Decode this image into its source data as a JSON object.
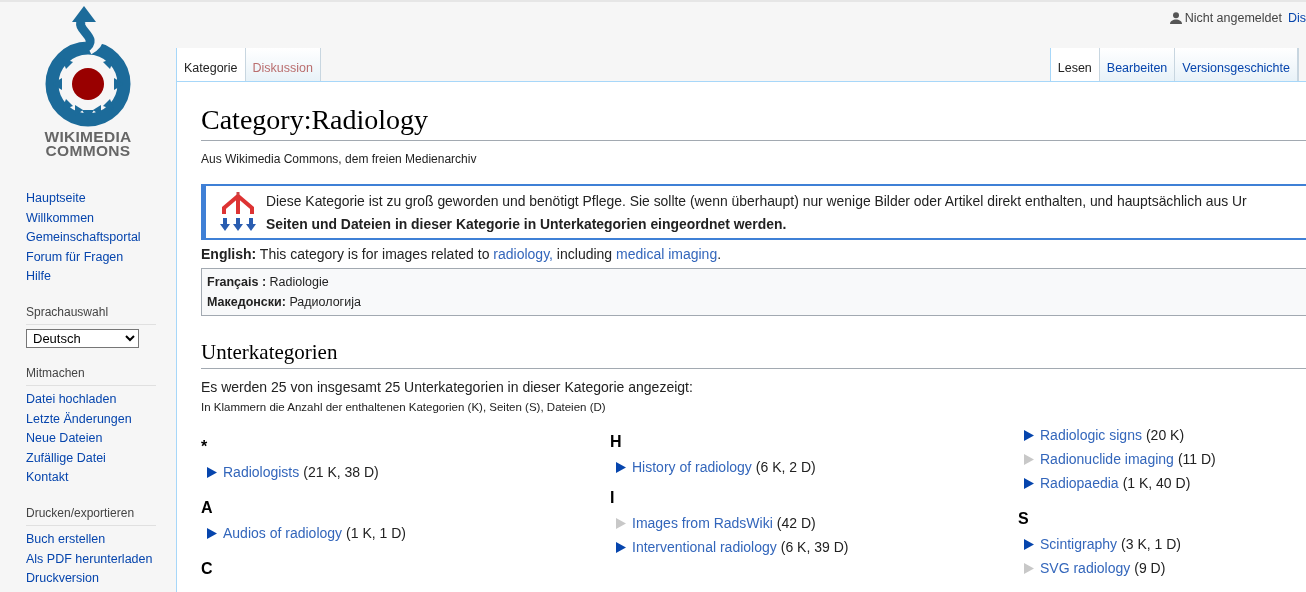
{
  "logo": {
    "text": "WIKIMEDIA COMMONS"
  },
  "sidebar": {
    "sections": [
      {
        "kind": "links",
        "items": [
          "Hauptseite",
          "Willkommen",
          "Gemeinschaftsportal",
          "Forum für Fragen",
          "Hilfe"
        ]
      },
      {
        "kind": "select",
        "heading": "Sprachauswahl",
        "value": "Deutsch"
      },
      {
        "kind": "links",
        "heading": "Mitmachen",
        "items": [
          "Datei hochladen",
          "Letzte Änderungen",
          "Neue Dateien",
          "Zufällige Datei",
          "Kontakt"
        ]
      },
      {
        "kind": "links",
        "heading": "Drucken/exportieren",
        "items": [
          "Buch erstellen",
          "Als PDF herunterladen",
          "Druckversion"
        ]
      }
    ]
  },
  "personal": {
    "user": "Nicht angemeldet",
    "link": "Dis"
  },
  "tabs_left": [
    {
      "label": "Kategorie",
      "selected": true,
      "missing": false
    },
    {
      "label": "Diskussion",
      "selected": false,
      "missing": true
    }
  ],
  "tabs_right": [
    {
      "label": "Lesen",
      "selected": true
    },
    {
      "label": "Bearbeiten",
      "selected": false
    },
    {
      "label": "Versionsgeschichte",
      "selected": false
    }
  ],
  "title": "Category:Radiology",
  "subtitle": "Aus Wikimedia Commons, dem freien Medienarchiv",
  "notice": {
    "line1": "Diese Kategorie ist zu groß geworden und benötigt Pflege. Sie sollte (wenn überhaupt) nur wenige Bilder oder Artikel direkt enthalten, und hauptsächlich aus Ur",
    "line2": "Seiten und Dateien in dieser Kategorie in Unterkategorien eingeordnet werden."
  },
  "description": {
    "lang": "English:",
    "before": "This category is for images related to ",
    "link1": "radiology,",
    "middle": " including ",
    "link2": "medical imaging",
    "after": "."
  },
  "translations": [
    {
      "lang": "Français :",
      "text": "Radiologie"
    },
    {
      "lang": "Македонски:",
      "text": "Радиологија"
    }
  ],
  "subcategories": {
    "heading": "Unterkategorien",
    "count_text": "Es werden 25 von insgesamt 25 Unterkategorien in dieser Kategorie angezeigt:",
    "legend": "In Klammern die Anzahl der enthaltenen Kategorien (K), Seiten (S), Dateien (D)",
    "columns": [
      {
        "groups": [
          {
            "letter": "*",
            "items": [
              {
                "name": "Radiologists",
                "count": "(21 K, 38 D)",
                "has_subcategories": true
              }
            ]
          },
          {
            "letter": "A",
            "items": [
              {
                "name": "Audios of radiology",
                "count": "(1 K, 1 D)",
                "has_subcategories": true
              }
            ]
          },
          {
            "letter": "C"
          }
        ]
      },
      {
        "groups": [
          {
            "letter": "H",
            "items": [
              {
                "name": "History of radiology",
                "count": "(6 K, 2 D)",
                "has_subcategories": true
              }
            ]
          },
          {
            "letter": "I",
            "items": [
              {
                "name": "Images from RadsWiki",
                "count": "(42 D)",
                "has_subcategories": false
              },
              {
                "name": "Interventional radiology",
                "count": "(6 K, 39 D)",
                "has_subcategories": true
              }
            ]
          }
        ]
      },
      {
        "groups": [
          {
            "items": [
              {
                "name": "Radiologic signs",
                "count": "(20 K)",
                "has_subcategories": true
              },
              {
                "name": "Radionuclide imaging",
                "count": "(11 D)",
                "has_subcategories": false
              },
              {
                "name": "Radiopaedia",
                "count": "(1 K, 40 D)",
                "has_subcategories": true
              }
            ]
          },
          {
            "letter": "S",
            "items": [
              {
                "name": "Scintigraphy",
                "count": "(3 K, 1 D)",
                "has_subcategories": true
              },
              {
                "name": "SVG radiology",
                "count": "(9 D)",
                "has_subcategories": false
              }
            ]
          }
        ]
      }
    ]
  }
}
